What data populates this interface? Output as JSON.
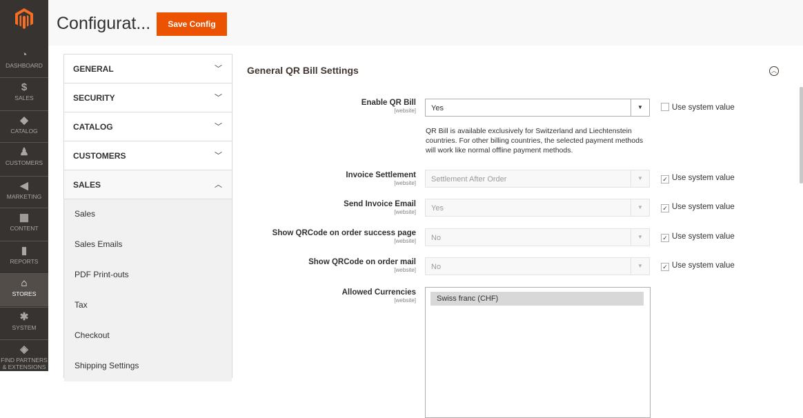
{
  "nav": {
    "items": [
      {
        "label": "DASHBOARD",
        "icon": "dashboard-icon",
        "glyph": "◔"
      },
      {
        "label": "SALES",
        "icon": "dollar-icon",
        "glyph": "$"
      },
      {
        "label": "CATALOG",
        "icon": "box-icon",
        "glyph": "◆"
      },
      {
        "label": "CUSTOMERS",
        "icon": "person-icon",
        "glyph": "♟"
      },
      {
        "label": "MARKETING",
        "icon": "megaphone-icon",
        "glyph": "◀"
      },
      {
        "label": "CONTENT",
        "icon": "layout-icon",
        "glyph": "▦"
      },
      {
        "label": "REPORTS",
        "icon": "bar-chart-icon",
        "glyph": "▮"
      },
      {
        "label": "STORES",
        "icon": "store-icon",
        "glyph": "⌂"
      },
      {
        "label": "SYSTEM",
        "icon": "gear-icon",
        "glyph": "✱"
      },
      {
        "label": "FIND PARTNERS & EXTENSIONS",
        "icon": "cube-icon",
        "glyph": "◈"
      }
    ]
  },
  "header": {
    "title": "Configurat...",
    "save_label": "Save Config"
  },
  "tabs": {
    "general": "GENERAL",
    "security": "SECURITY",
    "catalog": "CATALOG",
    "customers": "CUSTOMERS",
    "sales": "SALES",
    "sales_items": [
      "Sales",
      "Sales Emails",
      "PDF Print-outs",
      "Tax",
      "Checkout",
      "Shipping Settings"
    ]
  },
  "section": {
    "title": "General QR Bill Settings",
    "scope": "[website]",
    "use_system_value": "Use system value",
    "fields": {
      "enable": {
        "label": "Enable QR Bill",
        "value": "Yes"
      },
      "note": "QR Bill is available exclusively for Switzerland and Liechtenstein countries. For other billing countries, the selected payment methods will work like normal offline payment methods.",
      "invoice_settlement": {
        "label": "Invoice Settlement",
        "value": "Settlement After Order"
      },
      "send_invoice_email": {
        "label": "Send Invoice Email",
        "value": "Yes"
      },
      "show_qr_success": {
        "label": "Show QRCode on order success page",
        "value": "No"
      },
      "show_qr_mail": {
        "label": "Show QRCode on order mail",
        "value": "No"
      },
      "allowed_currencies": {
        "label": "Allowed Currencies",
        "options": [
          "Swiss franc (CHF)"
        ]
      }
    }
  },
  "colors": {
    "accent": "#eb5202",
    "nav_bg": "#373330"
  }
}
